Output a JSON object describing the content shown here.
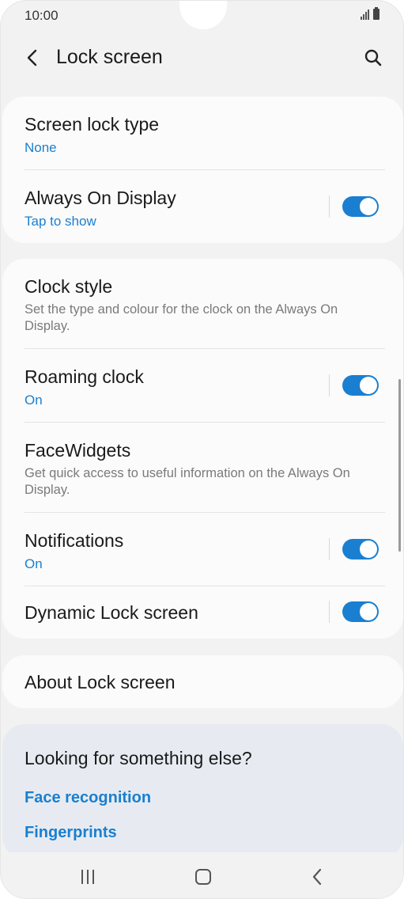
{
  "status_bar": {
    "time": "10:00"
  },
  "app_bar": {
    "title": "Lock screen"
  },
  "card1": {
    "screen_lock_type": {
      "title": "Screen lock type",
      "value": "None"
    },
    "always_on_display": {
      "title": "Always On Display",
      "value": "Tap to show",
      "enabled": true
    }
  },
  "card2": {
    "clock_style": {
      "title": "Clock style",
      "description": "Set the type and colour for the clock on the Always On Display."
    },
    "roaming_clock": {
      "title": "Roaming clock",
      "value": "On",
      "enabled": true
    },
    "facewidgets": {
      "title": "FaceWidgets",
      "description": "Get quick access to useful information on the Always On Display."
    },
    "notifications": {
      "title": "Notifications",
      "value": "On",
      "enabled": true
    },
    "dynamic_lock_screen": {
      "title": "Dynamic Lock screen",
      "enabled": true
    }
  },
  "card3": {
    "about": {
      "title": "About Lock screen"
    }
  },
  "suggestions": {
    "title": "Looking for something else?",
    "links": [
      "Face recognition",
      "Fingerprints"
    ]
  },
  "colors": {
    "accent": "#1a7fd0",
    "background": "#f2f2f2",
    "card": "#fbfbfb",
    "suggest_bg": "#e7ebf1"
  }
}
